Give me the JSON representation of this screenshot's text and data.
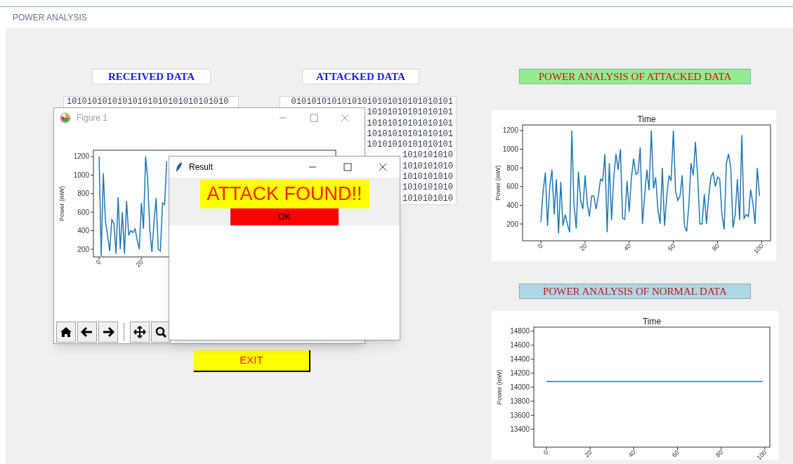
{
  "window": {
    "title": "POWER ANALYSIS"
  },
  "received": {
    "label": "RECEIVED DATA",
    "lines": [
      "10101010101010101010101010101010"
    ]
  },
  "attacked": {
    "label": "ATTACKED DATA",
    "lines": [
      "01010101010101010101010101010101",
      "10101010101010101",
      "10101010101010101",
      "10101010101010101",
      "10101010101010101",
      "1010101010",
      "1010101010",
      "1010101010",
      "1010101010",
      "1010101010"
    ]
  },
  "exit_button": "EXIT",
  "attacked_panel": {
    "label": "POWER ANALYSIS OF ATTACKED DATA",
    "chart_data": {
      "type": "line",
      "title": "Time",
      "ylabel": "Power (mW)",
      "x": [
        0,
        1,
        2,
        3,
        4,
        5,
        6,
        7,
        8,
        9,
        10,
        11,
        12,
        13,
        14,
        15,
        16,
        17,
        18,
        19,
        20,
        21,
        22,
        23,
        24,
        25,
        26,
        27,
        28,
        29,
        30,
        31,
        32,
        33,
        34,
        35,
        36,
        37,
        38,
        39,
        40,
        41,
        42,
        43,
        44,
        45,
        46,
        47,
        48,
        49,
        50,
        51,
        52,
        53,
        54,
        55,
        56,
        57,
        58,
        59,
        60,
        61,
        62,
        63,
        64,
        65,
        66,
        67,
        68,
        69,
        70,
        71,
        72,
        73,
        74,
        75,
        76,
        77,
        78,
        79,
        80,
        81,
        82,
        83,
        84,
        85,
        86,
        87,
        88,
        89,
        90,
        91,
        92,
        93,
        94,
        95,
        96,
        97,
        98,
        99
      ],
      "series": [
        {
          "color": "#1f77b4",
          "values": [
            220,
            550,
            750,
            180,
            600,
            780,
            300,
            680,
            100,
            650,
            180,
            300,
            200,
            110,
            1200,
            400,
            150,
            760,
            450,
            360,
            720,
            420,
            280,
            500,
            500,
            360,
            500,
            680,
            660,
            950,
            110,
            850,
            240,
            700,
            950,
            780,
            1000,
            260,
            250,
            660,
            330,
            700,
            900,
            730,
            750,
            1020,
            200,
            500,
            780,
            560,
            1200,
            580,
            700,
            350,
            200,
            800,
            180,
            500,
            720,
            660,
            1200,
            550,
            450,
            500,
            720,
            180,
            120,
            400,
            850,
            720,
            1080,
            700,
            200,
            200,
            520,
            200,
            500,
            700,
            750,
            600,
            700,
            680,
            300,
            140,
            850,
            950,
            800,
            160,
            300,
            680,
            240,
            1150,
            260,
            300,
            280,
            570,
            420,
            200,
            800,
            500
          ]
        }
      ],
      "xlim": [
        -8.3,
        104
      ],
      "ylim": [
        20,
        1260
      ],
      "xticks": [
        0,
        20,
        40,
        60,
        80,
        100
      ],
      "yticks": [
        200,
        400,
        600,
        800,
        1000,
        1200
      ]
    }
  },
  "normal_panel": {
    "label": "POWER ANALYSIS OF NORMAL DATA",
    "chart_data": {
      "type": "line",
      "title": "Time",
      "ylabel": "Power (mW)",
      "x": [
        0,
        99
      ],
      "series": [
        {
          "color": "#1f77b4",
          "values": [
            14080,
            14080
          ]
        }
      ],
      "xlim": [
        -5.8,
        102.3
      ],
      "ylim": [
        13143,
        14859
      ],
      "xticks": [
        0,
        20,
        40,
        60,
        80,
        100
      ],
      "yticks": [
        13400,
        13600,
        13800,
        14000,
        14200,
        14400,
        14600,
        14800
      ]
    }
  },
  "figure_window": {
    "title": "Figure 1",
    "chart_data": {
      "type": "line",
      "ylabel": "Power (mW)",
      "x": [
        0,
        1,
        2,
        3,
        4,
        5,
        6,
        7,
        8,
        9,
        10,
        11,
        12,
        13,
        14,
        15,
        16,
        17,
        18,
        19,
        20,
        21,
        22,
        23,
        24,
        25,
        26,
        27,
        28,
        29,
        30,
        31,
        32
      ],
      "series": [
        {
          "color": "#1f77b4",
          "values": [
            1200,
            130,
            1020,
            500,
            350,
            180,
            520,
            480,
            150,
            760,
            200,
            600,
            150,
            720,
            350,
            400,
            380,
            420,
            300,
            200,
            700,
            420,
            1200,
            950,
            400,
            170,
            500,
            750,
            200,
            180,
            700,
            680,
            1150
          ]
        }
      ],
      "xlim": [
        -2.7,
        112
      ],
      "ylim": [
        117,
        1268
      ],
      "xticks": [
        0,
        20
      ],
      "yticks": [
        200,
        400,
        600,
        800,
        1000,
        1200
      ]
    }
  },
  "result_window": {
    "title": "Result",
    "message": "ATTACK FOUND!!",
    "ok_button": "OK"
  }
}
